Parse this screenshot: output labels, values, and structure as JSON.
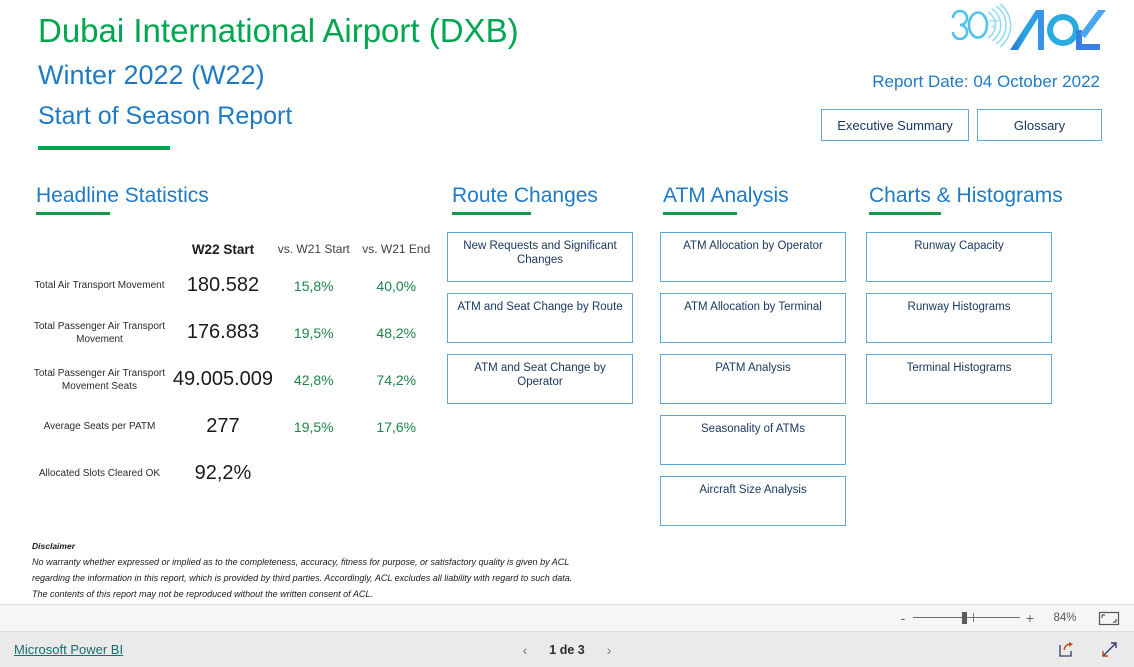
{
  "report": {
    "title_line1": "Dubai International Airport (DXB)",
    "title_line2": "Winter 2022 (W22)",
    "title_line3": "Start of Season Report",
    "report_date": "Report Date: 04 October 2022",
    "logo_alt": "acl-30-years-logo",
    "colors": {
      "green": "#00A550",
      "blue": "#1F7AC4",
      "rule_green": "#129A4D",
      "card_border": "#5AA9D6",
      "card_text": "#17375E",
      "pct_green": "#1E8449"
    }
  },
  "header_buttons": [
    {
      "label": "Executive Summary"
    },
    {
      "label": "Glossary"
    }
  ],
  "sections": {
    "headline": {
      "title": "Headline Statistics"
    },
    "route": {
      "title": "Route Changes"
    },
    "atm": {
      "title": "ATM Analysis"
    },
    "charts": {
      "title": "Charts & Histograms"
    }
  },
  "headline_stats": {
    "columns": [
      "",
      "W22 Start",
      "vs. W21 Start",
      "vs. W21 End"
    ],
    "rows": [
      {
        "label": "Total Air Transport Movement",
        "value": "180.582",
        "vs_w21_start": "15,8%",
        "vs_w21_end": "40,0%"
      },
      {
        "label": "Total Passenger Air Transport Movement",
        "value": "176.883",
        "vs_w21_start": "19,5%",
        "vs_w21_end": "48,2%"
      },
      {
        "label": "Total Passenger Air Transport Movement Seats",
        "value": "49.005.009",
        "vs_w21_start": "42,8%",
        "vs_w21_end": "74,2%"
      },
      {
        "label": "Average Seats per PATM",
        "value": "277",
        "vs_w21_start": "19,5%",
        "vs_w21_end": "17,6%"
      },
      {
        "label": "Allocated Slots Cleared OK",
        "value": "92,2%",
        "vs_w21_start": "",
        "vs_w21_end": ""
      }
    ]
  },
  "route_cards": [
    {
      "label": "New Requests and Significant Changes"
    },
    {
      "label": "ATM and Seat Change by Route"
    },
    {
      "label": "ATM and Seat Change by Operator"
    }
  ],
  "atm_cards": [
    {
      "label": "ATM Allocation by Operator"
    },
    {
      "label": "ATM Allocation by Terminal"
    },
    {
      "label": "PATM Analysis"
    },
    {
      "label": "Seasonality of ATMs"
    },
    {
      "label": "Aircraft Size Analysis"
    }
  ],
  "charts_cards": [
    {
      "label": "Runway Capacity"
    },
    {
      "label": "Runway Histograms"
    },
    {
      "label": "Terminal Histograms"
    }
  ],
  "disclaimer": {
    "title": "Disclaimer",
    "lines": [
      "No warranty whether expressed or implied as to the completeness, accuracy, fitness for purpose, or satisfactory quality is given by ACL",
      "regarding the information in this report, which is provided by third parties. Accordingly, ACL excludes all liability with regard to such data.",
      "The contents of this report may not be reproduced without the written consent of ACL."
    ]
  },
  "zoom_bar": {
    "minus_label": "-",
    "plus_label": "+",
    "zoom_level": "84%",
    "fit_icon": "fit-to-page-icon"
  },
  "bottom_bar": {
    "powerbi_label": "Microsoft Power BI",
    "prev_icon": "chevron-left-icon",
    "next_icon": "chevron-right-icon",
    "page_label": "1 de 3",
    "share_icon": "share-icon",
    "fullscreen_icon": "fullscreen-icon"
  }
}
